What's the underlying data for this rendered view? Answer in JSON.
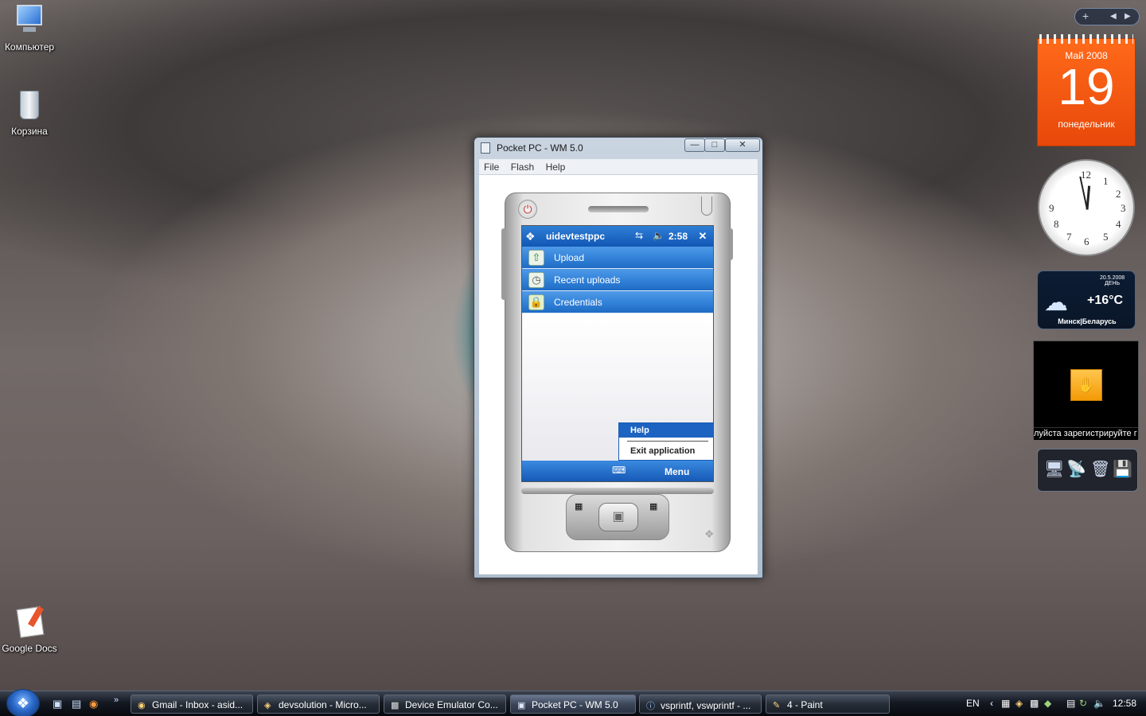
{
  "desktop": {
    "icons": [
      {
        "label": "Компьютер"
      },
      {
        "label": "Корзина"
      },
      {
        "label": "Google Docs"
      }
    ]
  },
  "window": {
    "title": "Pocket PC - WM 5.0",
    "menu": [
      "File",
      "Flash",
      "Help"
    ]
  },
  "pda": {
    "title": "uidevtestppc",
    "time": "2:58",
    "items": [
      {
        "label": "Upload",
        "icon": "upload-icon"
      },
      {
        "label": "Recent uploads",
        "icon": "clock-icon"
      },
      {
        "label": "Credentials",
        "icon": "lock-icon"
      }
    ],
    "popup": {
      "help": "Help",
      "exit": "Exit application"
    },
    "softkey_right": "Menu"
  },
  "gadgets": {
    "calendar": {
      "month_year": "Май 2008",
      "day": "19",
      "weekday": "понедельник"
    },
    "clock": {
      "hour": 12,
      "minute": 58
    },
    "weather": {
      "date": "20.5.2008",
      "period": "ДЕНЬ",
      "temp": "+16°C",
      "city": "Минск|Беларусь"
    },
    "slideshow": {
      "caption": "луйста зарегистрируйте г"
    }
  },
  "taskbar": {
    "tasks": [
      {
        "label": "Gmail - Inbox - asid..."
      },
      {
        "label": "devsolution - Micro..."
      },
      {
        "label": "Device Emulator Co..."
      },
      {
        "label": "Pocket PC - WM 5.0"
      },
      {
        "label": "vsprintf, vswprintf - ..."
      },
      {
        "label": "4 - Paint"
      }
    ],
    "lang": "EN",
    "time": "12:58"
  },
  "colors": {
    "pda_blue": "#2f7fd6",
    "calendar_orange": "#ff6a1a"
  }
}
